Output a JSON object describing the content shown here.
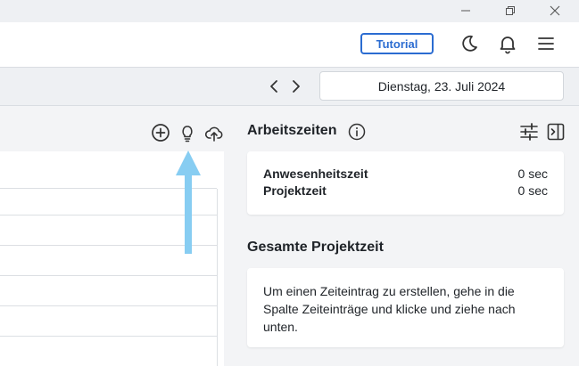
{
  "header": {
    "tutorial_label": "Tutorial"
  },
  "datebar": {
    "date": "Dienstag, 23. Juli 2024"
  },
  "worktime": {
    "title": "Arbeitszeiten",
    "rows": [
      {
        "label": "Anwesenheitszeit",
        "value": "0 sec"
      },
      {
        "label": "Projektzeit",
        "value": "0 sec"
      }
    ]
  },
  "project_total": {
    "title": "Gesamte Projektzeit",
    "text": "Um einen Zeiteintrag zu erstellen, gehe in die Spalte Zeiteinträge und klicke und ziehe nach unten."
  },
  "icons": {
    "window": [
      "minimize-icon",
      "restore-icon",
      "close-icon"
    ],
    "header": [
      "moon-icon",
      "bell-icon",
      "menu-icon"
    ],
    "tools": [
      "add-circle-icon",
      "lightbulb-icon",
      "cloud-upload-icon"
    ],
    "worktime": [
      "info-icon",
      "sliders-icon",
      "sidebar-panel-icon"
    ],
    "annotation": "arrow-up-icon"
  },
  "colors": {
    "accent": "#2b6cd1",
    "annotation_arrow": "#87cdf2"
  }
}
